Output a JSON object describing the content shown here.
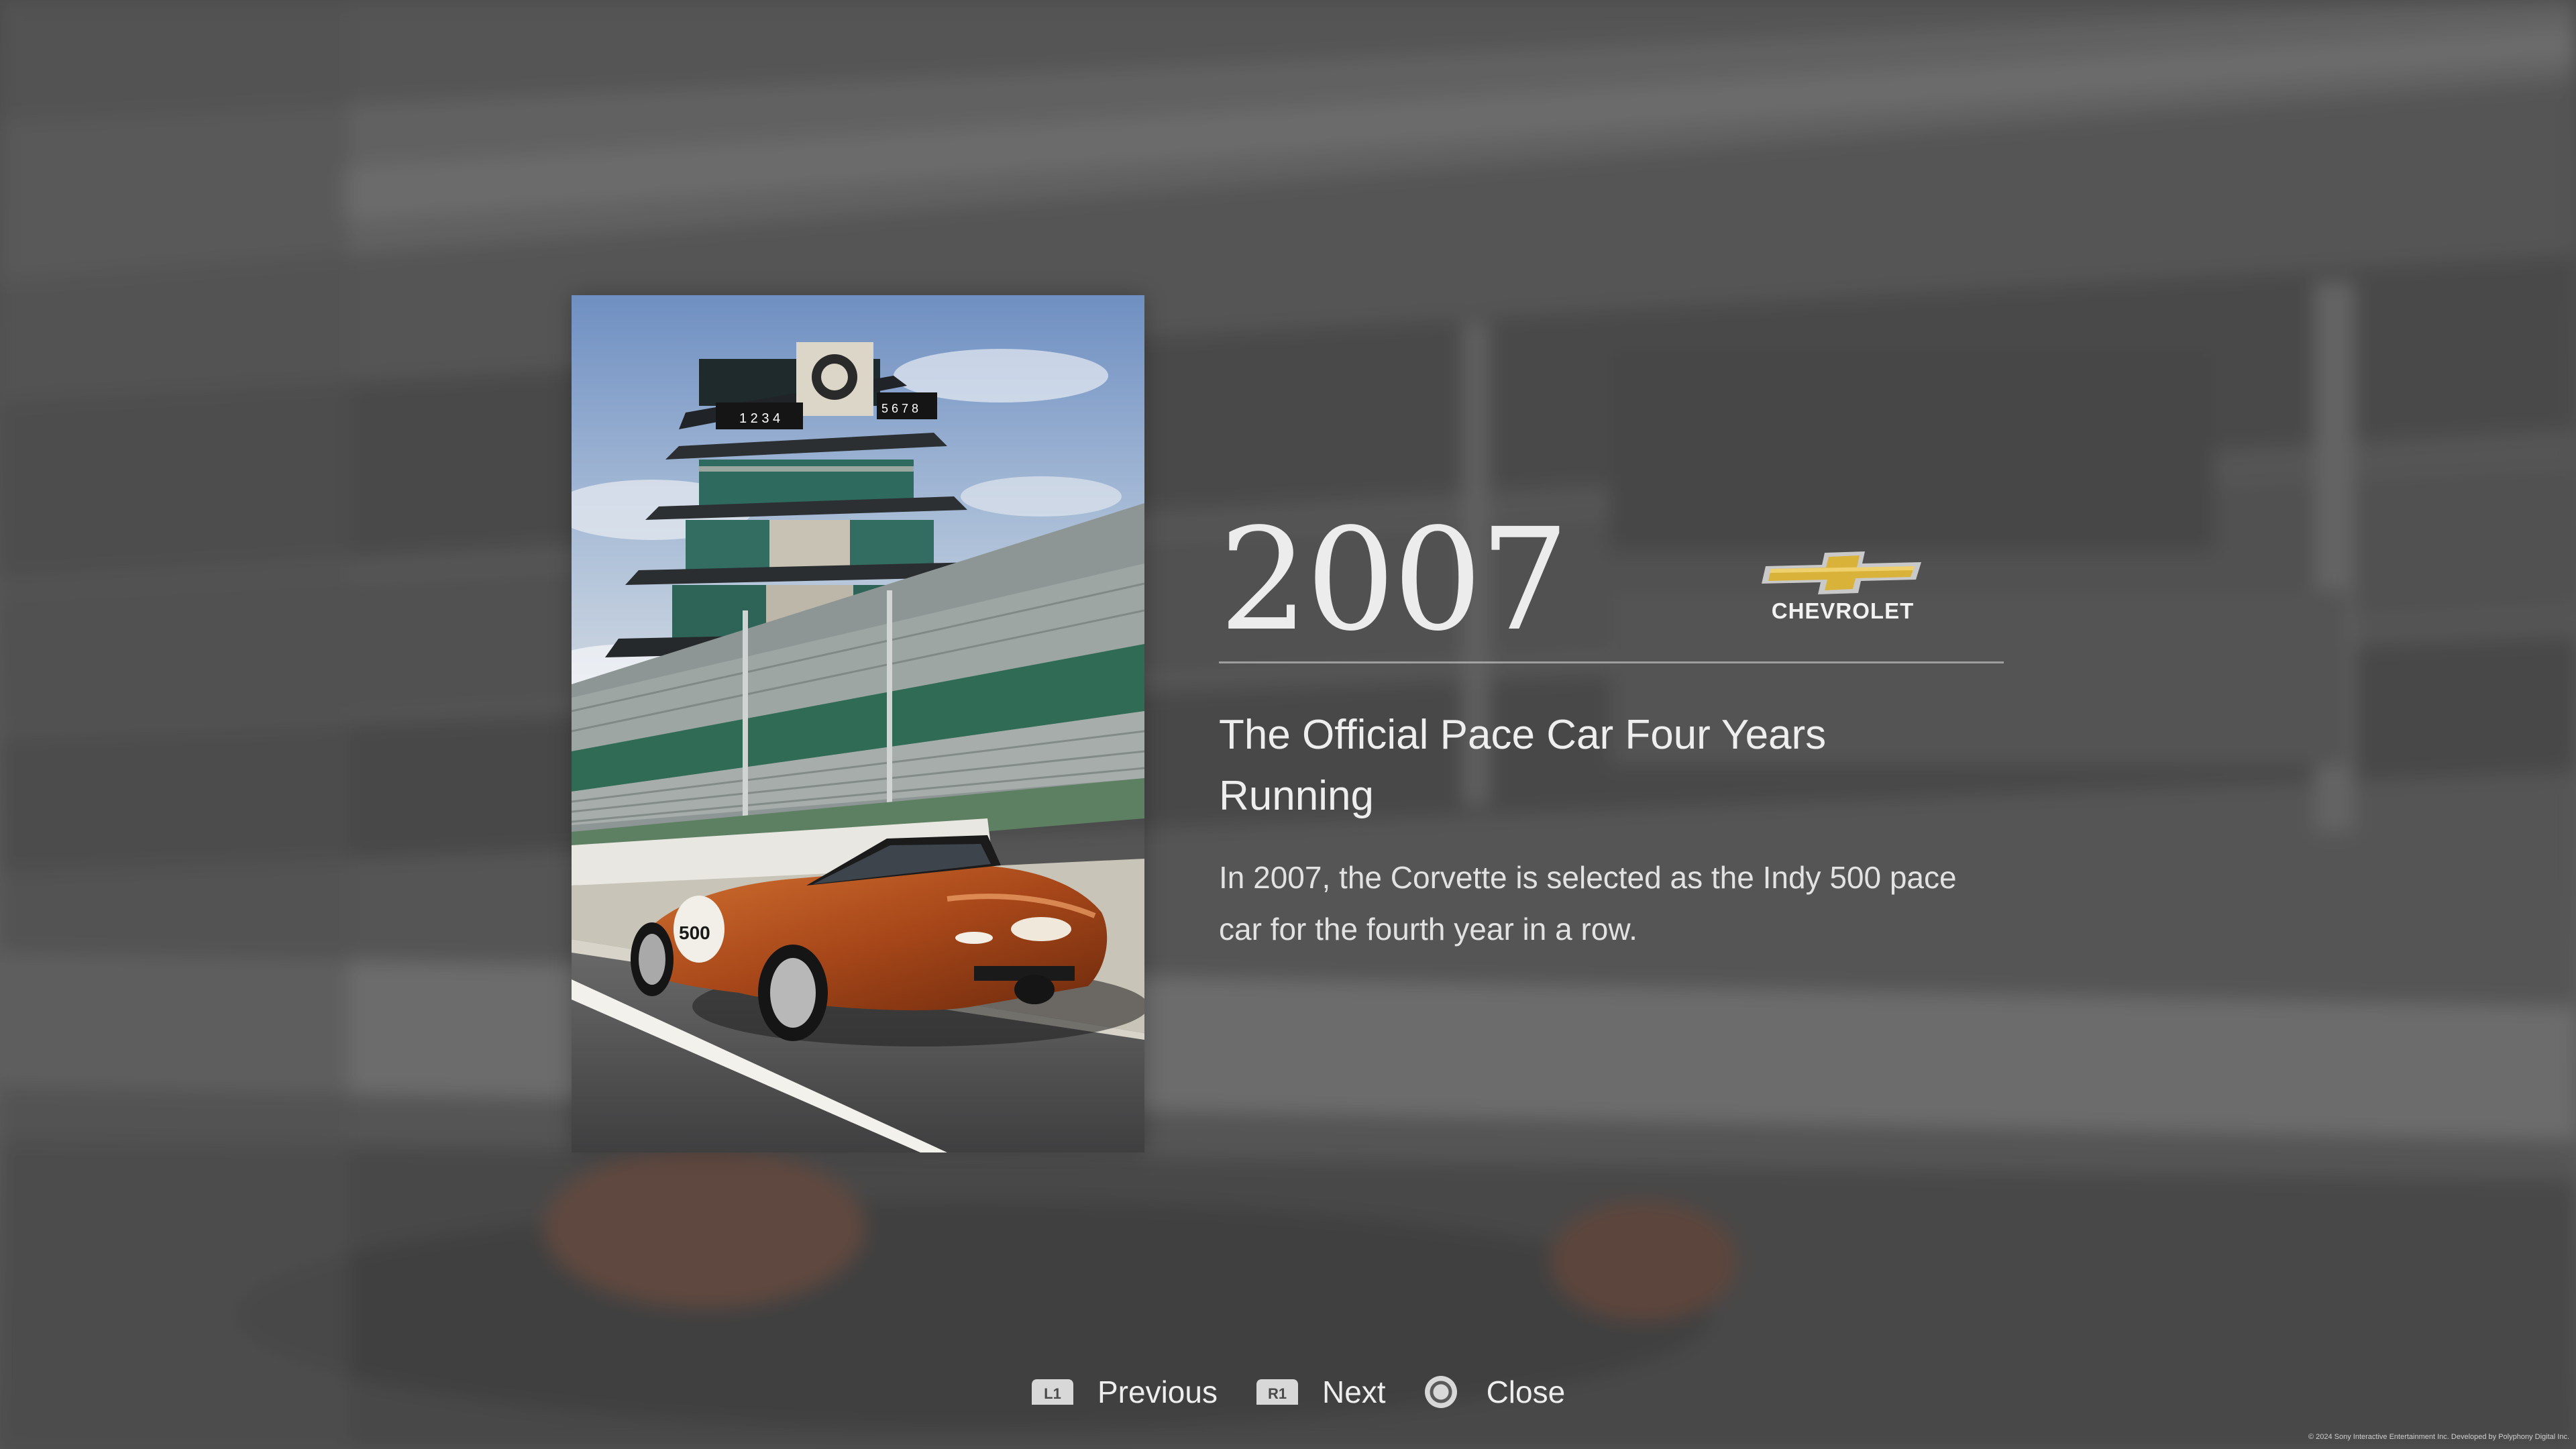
{
  "entry": {
    "year": "2007",
    "brand_name": "CHEVROLET",
    "headline": "The Official Pace Car Four Years Running",
    "description": "In 2007, the Corvette is selected as the Indy 500 pace car for the fourth year in a row."
  },
  "photo": {
    "pagoda_left_numbers": "1 2 3 4",
    "pagoda_right_numbers": "5 6 7 8",
    "car_number": "500"
  },
  "controls": {
    "previous": {
      "button": "L1",
      "label": "Previous"
    },
    "next": {
      "button": "R1",
      "label": "Next"
    },
    "close": {
      "label": "Close"
    }
  },
  "footer": {
    "copyright": "© 2024 Sony Interactive Entertainment Inc. Developed by Polyphony Digital Inc."
  },
  "colors": {
    "chevrolet_gold": "#d9b23a",
    "car_orange": "#b5541c"
  }
}
